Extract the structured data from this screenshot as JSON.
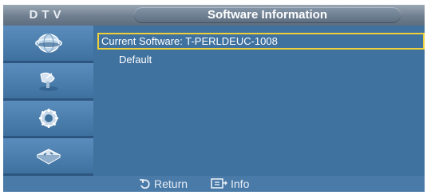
{
  "header": {
    "tag": "DTV",
    "title": "Software Information"
  },
  "sidebar": {
    "items": [
      {
        "icon": "globe-icon"
      },
      {
        "icon": "satellite-dish-icon"
      },
      {
        "icon": "gear-icon"
      },
      {
        "icon": "input-source-icon"
      }
    ]
  },
  "content": {
    "current_software": "Current Software: T-PERLDEUC-1008",
    "default_label": "Default"
  },
  "footer": {
    "return_label": "Return",
    "info_label": "Info"
  },
  "colors": {
    "background": "#3c6f9e",
    "selection": "#f0d03a"
  }
}
